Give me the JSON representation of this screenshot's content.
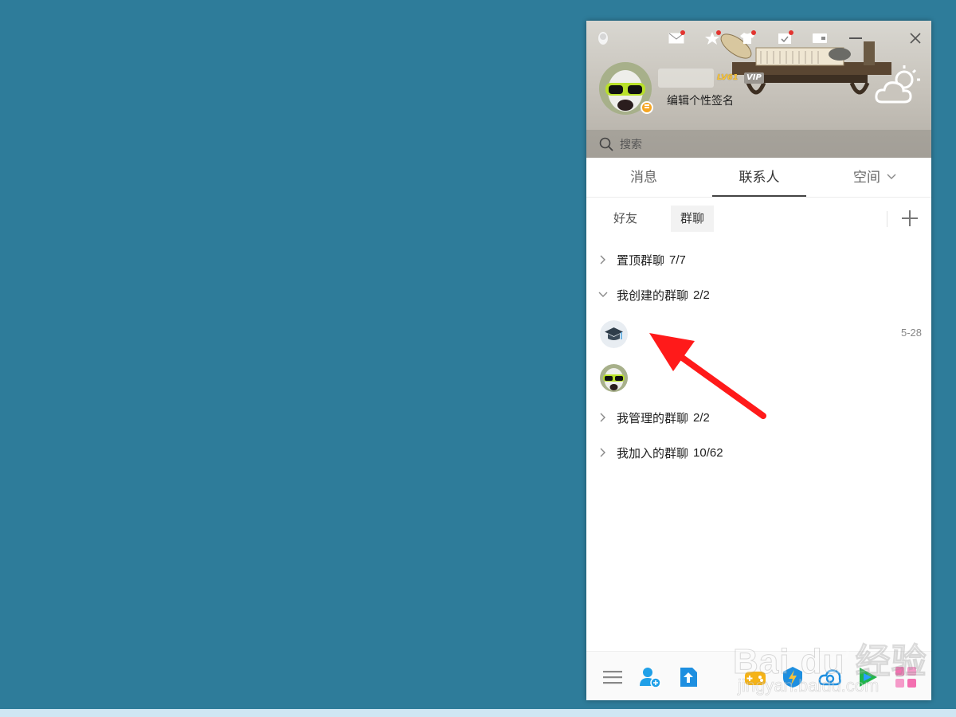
{
  "profile": {
    "level_badge": "LV61",
    "vip_badge": "VIP",
    "signature": "编辑个性签名"
  },
  "search": {
    "placeholder": "搜索"
  },
  "tabs": [
    {
      "label": "消息"
    },
    {
      "label": "联系人",
      "active": true
    },
    {
      "label": "空间"
    }
  ],
  "subtabs": [
    {
      "label": "好友"
    },
    {
      "label": "群聊",
      "active": true
    }
  ],
  "groups": {
    "pinned": {
      "label": "置顶群聊",
      "count": "7/7",
      "expanded": false
    },
    "created": {
      "label": "我创建的群聊",
      "count": "2/2",
      "expanded": true
    },
    "managed": {
      "label": "我管理的群聊",
      "count": "2/2",
      "expanded": false
    },
    "joined": {
      "label": "我加入的群聊",
      "count": "10/62",
      "expanded": false
    }
  },
  "created_chats": [
    {
      "avatar": "graduation-cap-icon",
      "time": "5-28"
    },
    {
      "avatar": "goggles-user-avatar",
      "time": ""
    }
  ],
  "watermark": {
    "main": "Bai du 经验",
    "sub": "jingyan.baidu.com"
  },
  "colors": {
    "desktop": "#2e7c9a",
    "annotation_arrow": "#ff1a1a",
    "status_away": "#f5a623",
    "notification_dot": "#e3342f"
  }
}
